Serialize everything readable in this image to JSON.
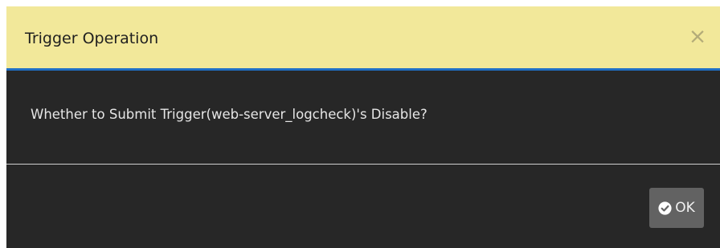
{
  "dialog": {
    "title": "Trigger Operation",
    "close_glyph": "×",
    "message": "Whether to Submit Trigger(web-server_logcheck)'s Disable?",
    "ok_label": "OK",
    "icons": {
      "close": "close-icon",
      "ok": "check-circle-icon"
    },
    "colors": {
      "header_bg": "#f2e89a",
      "header_border": "#1f6fc5",
      "body_bg": "#272727",
      "button_bg": "#626262"
    }
  }
}
